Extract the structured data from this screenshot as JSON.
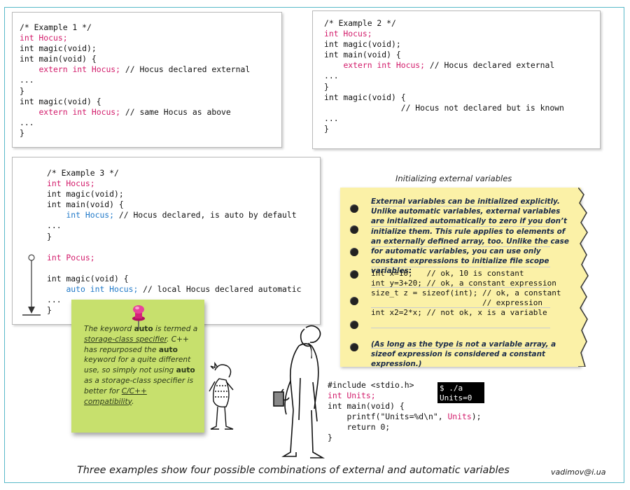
{
  "example1": {
    "comment": "/* Example 1 */",
    "line_int_hocus": "int Hocus;",
    "line_magic_decl": "int magic(void);",
    "line_main": "int main(void) {",
    "line_extern": "extern int Hocus;",
    "line_extern_comment": "// Hocus declared external",
    "ellipsis": "...",
    "close": "}",
    "line_magic_def": "int magic(void) {",
    "line_extern2": "extern int Hocus;",
    "line_extern2_comment": "// same Hocus as above"
  },
  "example2": {
    "comment": "/* Example 2 */",
    "line_int_hocus": "int Hocus;",
    "line_magic_decl": "int magic(void);",
    "line_main": "int main(void) {",
    "line_extern": "extern int Hocus;",
    "line_extern_comment": "// Hocus declared external",
    "ellipsis": "...",
    "close": "}",
    "line_magic_def": "int magic(void) {",
    "line_known_comment": "// Hocus not declared but is known"
  },
  "example3": {
    "comment": "/* Example 3 */",
    "line_int_hocus": "int Hocus;",
    "line_magic_decl": "int magic(void);",
    "line_main": "int main(void) {",
    "line_auto_hocus": "int Hocus;",
    "line_auto_comment": "// Hocus declared, is auto by default",
    "ellipsis": "...",
    "close": "}",
    "line_int_pocus": "int Pocus;",
    "line_magic_def": "int magic(void) {",
    "line_auto_kw": "auto int Hocus;",
    "line_auto_kw_comment": "// local Hocus declared automatic"
  },
  "init_note": {
    "title": "Initializing external variables",
    "paragraph": "External variables can be initialized explicitly. Unlike automatic variables, external variables are initialized automatically to zero if you don’t initialize them. This rule applies to elements of an externally defined array, too. Unlike the case for automatic variables, you can use only constant expressions to initialize file scope variables:",
    "code_lines": [
      "int x=10;   // ok, 10 is constant",
      "int y=3+20; // ok, a constant expression",
      "size_t z = sizeof(int); // ok, a constant",
      "                        // expression",
      "int x2=2*x; // not ok, x is a variable"
    ],
    "footer": "(As long as the type is not a variable array, a sizeof expression is considered a constant expression.)"
  },
  "sticky_note": {
    "t1": "The keyword ",
    "kw1": "auto",
    "t2": " is termed a ",
    "link1": "storage-class specifier",
    "t3": ". C++ has repurposed the ",
    "kw2": "auto",
    "t4": " keyword for a quite different use, so simply not using ",
    "kw3": "auto",
    "t5": " as a storage-class specifier is better for ",
    "link2": "C/C++ compatibility",
    "t6": "."
  },
  "units_program": {
    "include": "#include <stdio.h>",
    "int_units": "int Units;",
    "main": "int main(void) {",
    "printf_pre": "printf(\"Units=%d\\n\", ",
    "printf_arg": "Units",
    "printf_post": ");",
    "return": "return 0;",
    "close": "}"
  },
  "terminal": {
    "command": "$ ./a",
    "output": "Units=0"
  },
  "caption": "Three examples show four possible combinations of external and automatic variables",
  "email": "vadimov@i.ua",
  "colors": {
    "keyword": "#d21a6a",
    "auto_keyword": "#1f78c8",
    "note_yellow": "#fbf1a7",
    "sticky_green": "#c7e06d",
    "frame_teal": "#58b9c9"
  }
}
